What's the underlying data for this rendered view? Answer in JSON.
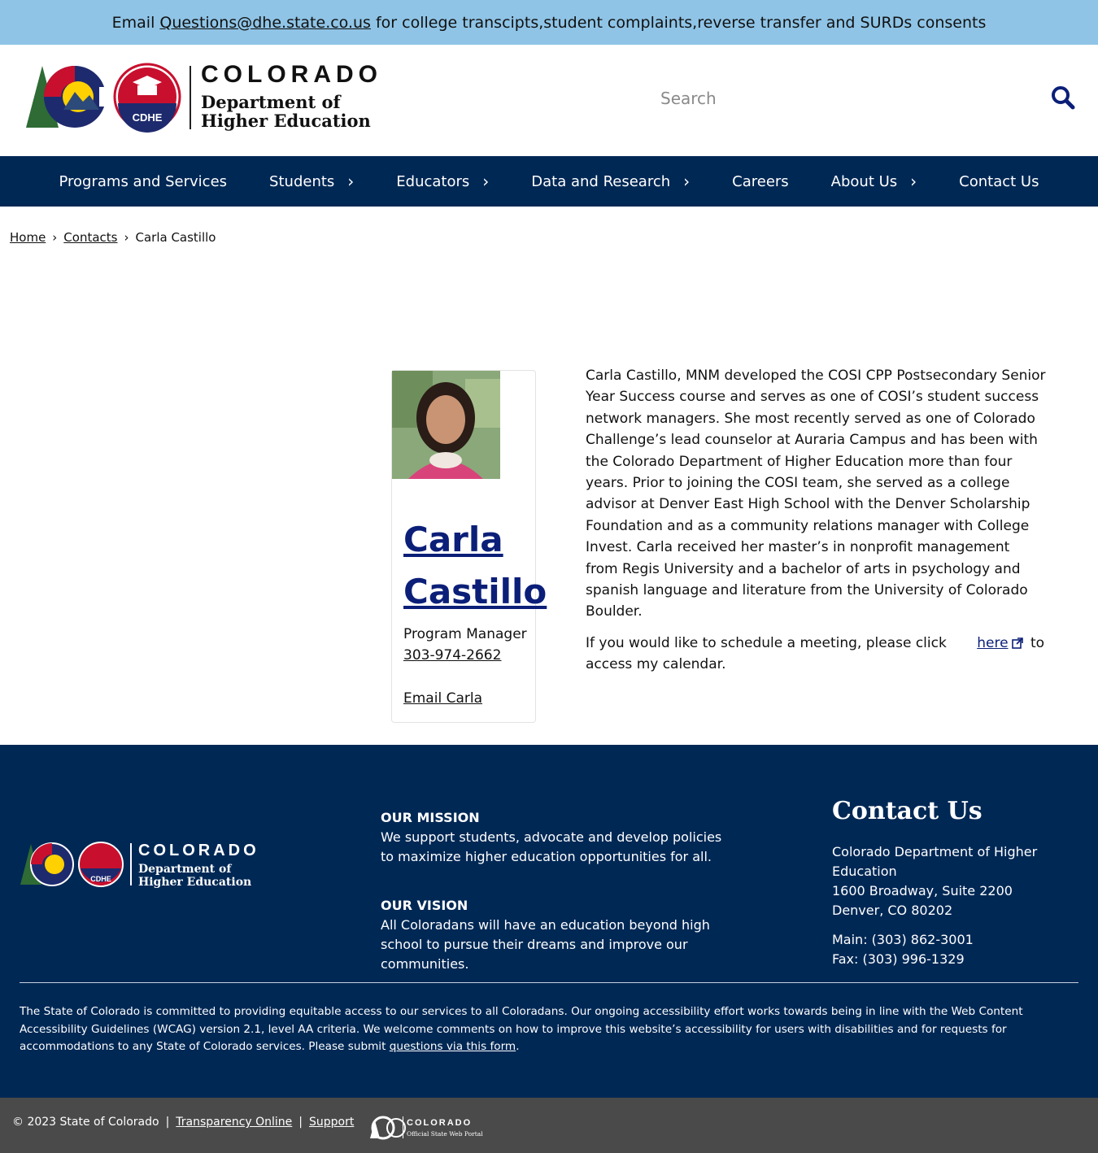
{
  "alert": {
    "prefix": "Email",
    "email": "Questions@dhe.state.co.us",
    "suffix": "for college transcipts,student complaints,reverse transfer and SURDs consents"
  },
  "header": {
    "logo_word": "COLORADO",
    "logo_line1": "Department of",
    "logo_line2": "Higher Education",
    "logo_badge": "CDHE",
    "search_placeholder": "Search"
  },
  "nav": {
    "items": [
      {
        "label": "Programs and Services",
        "has_submenu": false
      },
      {
        "label": "Students",
        "has_submenu": true
      },
      {
        "label": "Educators",
        "has_submenu": true
      },
      {
        "label": "Data and Research",
        "has_submenu": true
      },
      {
        "label": "Careers",
        "has_submenu": false
      },
      {
        "label": "About Us",
        "has_submenu": true
      },
      {
        "label": "Contact Us",
        "has_submenu": false
      }
    ],
    "chevron": "›"
  },
  "breadcrumb": {
    "home": "Home",
    "contacts": "Contacts",
    "current": "Carla Castillo",
    "separator": "›"
  },
  "profile": {
    "first_name": "Carla",
    "last_name": "Castillo",
    "title": "Program Manager",
    "phone": "303-974-2662",
    "email_label": "Email Carla"
  },
  "bio": {
    "paragraph": "Carla Castillo, MNM developed the COSI CPP Postsecondary Senior Year Success course and serves as one of COSI’s student success network managers. She most recently served as one of Colorado Challenge’s lead counselor at Auraria Campus and has been with the Colorado Department of Higher Education more than four years. Prior to joining the COSI team, she served as a college advisor at Denver East High School with the Denver Scholarship Foundation and as a community relations manager with College Invest. Carla received her master’s in nonprofit management from Regis University and a bachelor of arts in psychology and spanish language and literature from the University of Colorado Boulder.",
    "schedule_prefix": "If you would like to schedule a meeting, please click",
    "schedule_link": "here",
    "schedule_suffix": "to access my calendar."
  },
  "footer": {
    "mission_heading": "OUR MISSION",
    "mission_text": "We support students, advocate and develop policies to maximize higher education opportunities for all.",
    "vision_heading": "OUR VISION",
    "vision_text": "All Coloradans will have an education beyond high school to pursue their dreams and improve our communities.",
    "contact_heading": "Contact Us",
    "address_line1": "Colorado Department of Higher Education",
    "address_line2": "1600 Broadway, Suite 2200",
    "address_line3": "Denver, CO 80202",
    "main_phone": "Main: (303) 862-3001",
    "fax": "Fax: (303) 996-1329",
    "accessibility_text": "The State of Colorado is committed to providing equitable access to our services to all Coloradans. Our ongoing accessibility effort works towards being in line with the Web Content Accessibility Guidelines (WCAG) version 2.1, level AA criteria. We welcome comments on how to improve this website’s accessibility for users with disabilities and for requests for accommodations to any State of Colorado services. Please submit",
    "accessibility_link": "questions via this form",
    "accessibility_end": "."
  },
  "subfooter": {
    "copyright": "© 2023 State of Colorado",
    "sep": "|",
    "transparency": "Transparency Online",
    "support": "Support",
    "portal_word": "COLORADO",
    "portal_sub": "Official State Web Portal"
  },
  "colors": {
    "alert_bg": "#8fc4e6",
    "nav_bg": "#002855",
    "link_blue": "#0b1f78",
    "subfooter_bg": "#4a4a4a"
  }
}
